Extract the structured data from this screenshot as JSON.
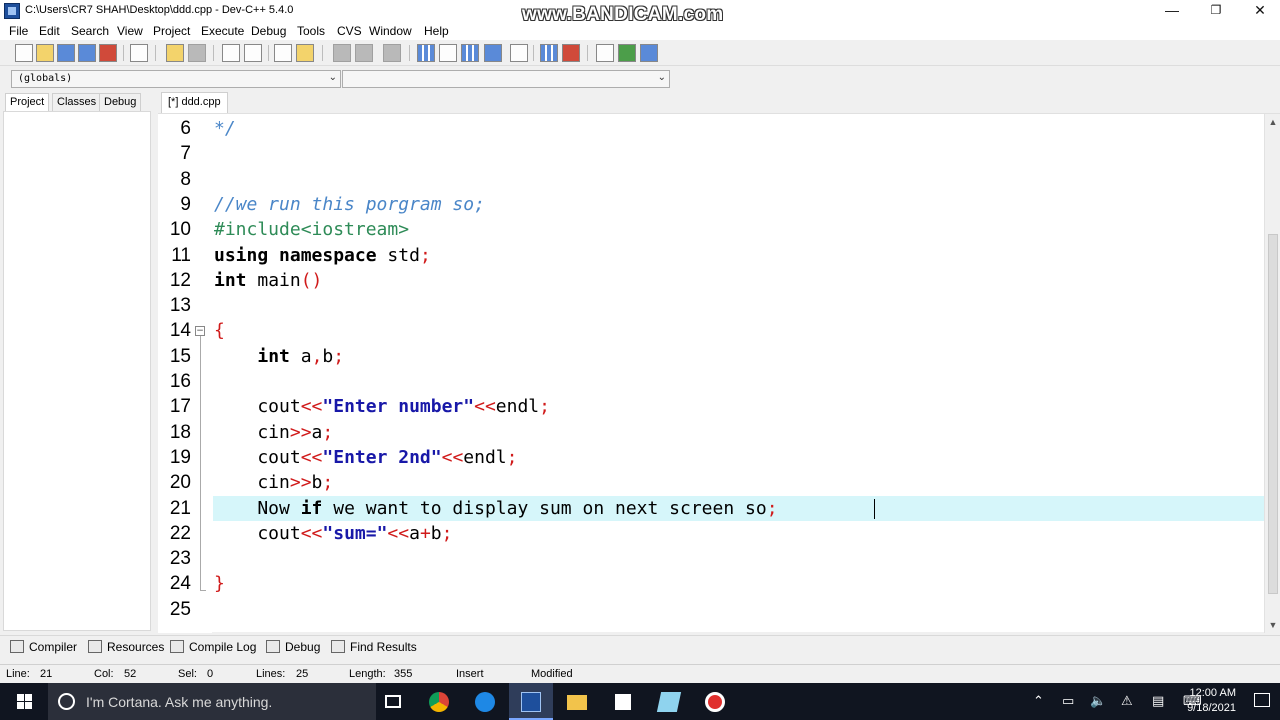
{
  "window": {
    "title": "C:\\Users\\CR7 SHAH\\Desktop\\ddd.cpp - Dev-C++ 5.4.0",
    "watermark": "www.BANDICAM.com",
    "minimize": "—",
    "restore": "❐",
    "close": "✕"
  },
  "menu": [
    "File",
    "Edit",
    "Search",
    "View",
    "Project",
    "Execute",
    "Debug",
    "Tools",
    "CVS",
    "Window",
    "Help"
  ],
  "combos": {
    "scope": "(globals)",
    "member": ""
  },
  "left_tabs": [
    "Project",
    "Classes",
    "Debug"
  ],
  "editor_tab": "[*] ddd.cpp",
  "code_lines": [
    {
      "n": "6",
      "text": "*/"
    },
    {
      "n": "7",
      "text": ""
    },
    {
      "n": "8",
      "text": ""
    },
    {
      "n": "9",
      "text": "//we run this porgram so;"
    },
    {
      "n": "10",
      "text": "#include<iostream>"
    },
    {
      "n": "11",
      "text": "using namespace std;"
    },
    {
      "n": "12",
      "text": "int main()"
    },
    {
      "n": "13",
      "text": ""
    },
    {
      "n": "14",
      "text": "{"
    },
    {
      "n": "15",
      "text": "    int a,b;"
    },
    {
      "n": "16",
      "text": ""
    },
    {
      "n": "17",
      "text": "    cout<<\"Enter number\"<<endl;"
    },
    {
      "n": "18",
      "text": "    cin>>a;"
    },
    {
      "n": "19",
      "text": "    cout<<\"Enter 2nd\"<<endl;"
    },
    {
      "n": "20",
      "text": "    cin>>b;"
    },
    {
      "n": "21",
      "text": "    Now if we want to display sum on next screen so;"
    },
    {
      "n": "22",
      "text": "    cout<<\"sum=\"<<a+b;"
    },
    {
      "n": "23",
      "text": ""
    },
    {
      "n": "24",
      "text": "}"
    },
    {
      "n": "25",
      "text": ""
    }
  ],
  "bottom_tabs": [
    "Compiler",
    "Resources",
    "Compile Log",
    "Debug",
    "Find Results"
  ],
  "status": {
    "line_label": "Line:",
    "line": "21",
    "col_label": "Col:",
    "col": "52",
    "sel_label": "Sel:",
    "sel": "0",
    "lines_label": "Lines:",
    "lines": "25",
    "length_label": "Length:",
    "length": "355",
    "mode": "Insert",
    "state": "Modified"
  },
  "taskbar": {
    "search_placeholder": "I'm Cortana. Ask me anything.",
    "time": "12:00 AM",
    "date": "9/18/2021"
  }
}
